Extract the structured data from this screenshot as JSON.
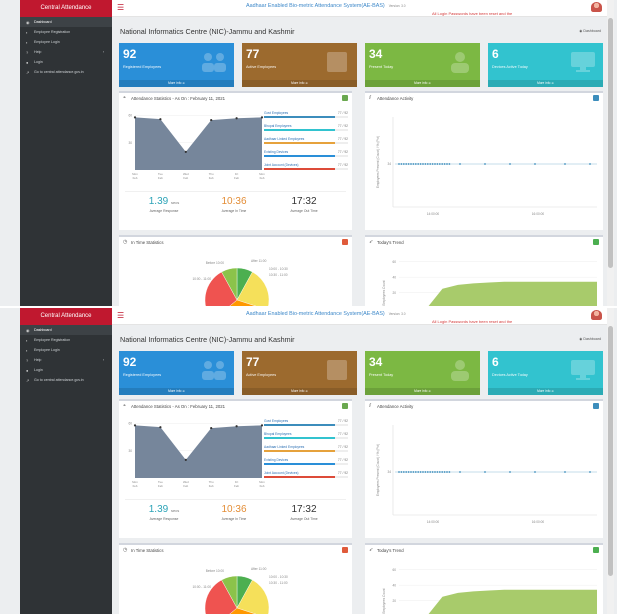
{
  "sidebar": {
    "brand": "Central Attendance",
    "items": [
      {
        "label": "Dashboard",
        "icon": "dashboard-icon",
        "glyph": "◉"
      },
      {
        "label": "Employee Registration",
        "icon": "user-add-icon",
        "glyph": "▪"
      },
      {
        "label": "Employee Login",
        "icon": "user-icon",
        "glyph": "▪"
      },
      {
        "label": "Help",
        "icon": "help-icon",
        "glyph": "?"
      },
      {
        "label": "Login",
        "icon": "login-icon",
        "glyph": "●"
      },
      {
        "label": "Go to central attendance.gov.in",
        "icon": "link-icon",
        "glyph": "↗"
      }
    ]
  },
  "header": {
    "title": "Aadhaar Enabled Bio-metric Attendance System(AE-BAS)",
    "version": "Version: 3.0",
    "notice": "All Login Passwords have been reset and the"
  },
  "page": {
    "org_title": "National Informatics Centre (NIC)-Jammu and Kashmir",
    "breadcrumb": "Dashboard"
  },
  "cards": [
    {
      "value": "92",
      "label": "Registered Employees",
      "more": "More info",
      "color": "#2a8fd8",
      "icon": "employees-icon"
    },
    {
      "value": "77",
      "label": "Active Employees",
      "more": "More info",
      "color": "#9c6a2e",
      "icon": "book-icon"
    },
    {
      "value": "34",
      "label": "Present Today",
      "more": "More info",
      "color": "#7cb843",
      "icon": "person-icon"
    },
    {
      "value": "6",
      "label": "Devices Active Today",
      "more": "More info",
      "color": "#32c3cf",
      "icon": "monitor-icon"
    }
  ],
  "panels": {
    "stats": {
      "title": "Attendance Statistics - As On : February 11, 2021",
      "button_color": "#6aa84f"
    },
    "activity": {
      "title": "Attendance Activity",
      "button_color": "#3c8dbc"
    },
    "intime": {
      "title": "In Time Statistics",
      "button_color": "#e05b3b"
    },
    "trend": {
      "title": "Today's Trend",
      "button_color": "#4caf50"
    }
  },
  "stats_legend": [
    {
      "name": "Govt Employees",
      "value": "77 / 92",
      "color": "#3c8dbc",
      "fraction": 0.84
    },
    {
      "name": "Bhopal Employees",
      "value": "77 / 92",
      "color": "#32c3cf",
      "fraction": 0.84
    },
    {
      "name": "Aadhaar Linked Employees",
      "value": "77 / 92",
      "color": "#e6a23c",
      "fraction": 0.84
    },
    {
      "name": "Existing Devices",
      "value": "77 / 92",
      "color": "#2a8fd8",
      "fraction": 0.84
    },
    {
      "name": "Joint Account (Devices)",
      "value": "77 / 92",
      "color": "#dd4b39",
      "fraction": 0.84
    }
  ],
  "stats_summary": [
    {
      "value": "1.39",
      "unit": "secs",
      "label": "Average Response"
    },
    {
      "value": "10:36",
      "unit": "",
      "label": "Average In Time"
    },
    {
      "value": "17:32",
      "unit": "",
      "label": "Average Out Time"
    }
  ],
  "chart_data": [
    {
      "type": "area",
      "title": "",
      "y_ticks": [
        "60",
        "30"
      ],
      "x": [
        "Mon Feb",
        "Tue Feb",
        "Wed Feb",
        "Thu Feb",
        "Fri Feb",
        "Mon Feb"
      ],
      "values": [
        58,
        56,
        20,
        55,
        57,
        58
      ],
      "ylim": [
        0,
        65
      ],
      "color": "#6f7f96"
    },
    {
      "type": "scatter",
      "ylabel": "Employees Present (Count) / % (Pct)",
      "x_ticks": [
        "14:00:00",
        "16:00:00"
      ],
      "y": 34,
      "color": "#3c8dbc"
    },
    {
      "type": "pie",
      "labels": [
        "Before 10:00",
        "After 11:00",
        "10:00 - 10:30",
        "10:30 - 11:00",
        "10:00 - 11:00"
      ],
      "values": [
        8,
        22,
        34,
        28,
        8
      ],
      "colors": [
        "#4caf50",
        "#f5e05a",
        "#ff9800",
        "#ef5350",
        "#8bc34a"
      ]
    },
    {
      "type": "area",
      "ylabel": "Employees Count",
      "y_ticks": [
        "60",
        "40",
        "20"
      ],
      "ylim": [
        0,
        70
      ],
      "values": [
        0,
        25,
        30,
        32,
        33,
        34,
        34,
        34,
        34,
        34,
        34,
        34
      ],
      "color": "#a3c863"
    }
  ]
}
